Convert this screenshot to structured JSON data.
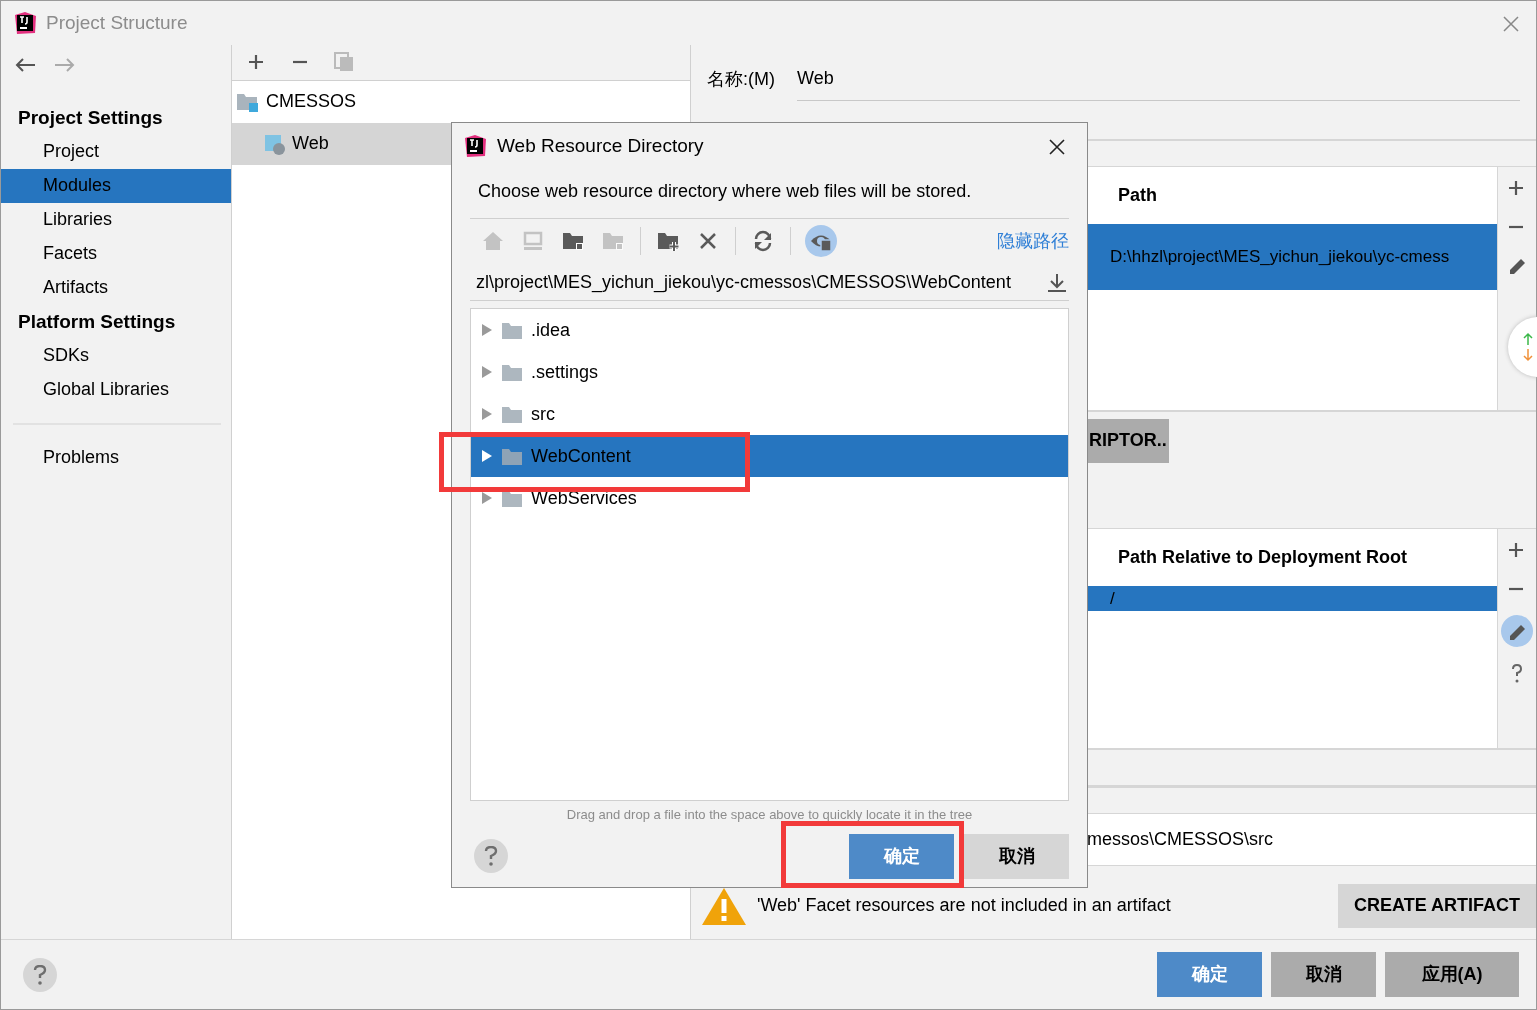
{
  "window": {
    "title": "Project Structure"
  },
  "sidebar": {
    "sections": [
      {
        "heading": "Project Settings",
        "items": [
          {
            "label": "Project",
            "selected": false
          },
          {
            "label": "Modules",
            "selected": true
          },
          {
            "label": "Libraries",
            "selected": false
          },
          {
            "label": "Facets",
            "selected": false
          },
          {
            "label": "Artifacts",
            "selected": false
          }
        ]
      },
      {
        "heading": "Platform Settings",
        "items": [
          {
            "label": "SDKs",
            "selected": false
          },
          {
            "label": "Global Libraries",
            "selected": false
          }
        ]
      }
    ],
    "bottom_items": [
      {
        "label": "Problems",
        "selected": false
      }
    ]
  },
  "module_tree": [
    {
      "label": "CMESSOS",
      "kind": "module",
      "selected": false,
      "children": [
        {
          "label": "Web",
          "kind": "facet",
          "selected": true
        }
      ]
    }
  ],
  "facet": {
    "name_label": "名称:(M)",
    "name_value": "Web",
    "descriptors_table": {
      "columns": [
        "Path"
      ],
      "rows": [
        {
          "cells": [
            "D:\\hhzl\\project\\MES_yichun_jiekou\\yc-cmess"
          ],
          "selected": true
        }
      ]
    },
    "descriptor_button": "RIPTOR..",
    "roots_table": {
      "columns": [
        "Path Relative to Deployment Root"
      ],
      "rows": [
        {
          "cells": [
            "/"
          ],
          "selected": true
        }
      ]
    },
    "source_root": "messos\\CMESSOS\\src",
    "warning": "'Web' Facet resources are not included in an artifact",
    "create_button": "CREATE ARTIFACT"
  },
  "buttons": [
    {
      "label": "确定",
      "kind": "primary"
    },
    {
      "label": "取消",
      "kind": "secondary"
    },
    {
      "label": "应用(A)",
      "kind": "secondary"
    }
  ],
  "dialog": {
    "title": "Web Resource Directory",
    "description": "Choose web resource directory where web files will be stored.",
    "toolbar": [
      {
        "kind": "home",
        "disabled": true
      },
      {
        "kind": "desktop",
        "disabled": true
      },
      {
        "kind": "module-folder",
        "disabled": false
      },
      {
        "kind": "project-folder",
        "disabled": true
      },
      {
        "kind": "separator"
      },
      {
        "kind": "new-folder",
        "disabled": false
      },
      {
        "kind": "delete",
        "disabled": false
      },
      {
        "kind": "separator"
      },
      {
        "kind": "refresh",
        "disabled": false
      },
      {
        "kind": "separator"
      },
      {
        "kind": "show-hidden",
        "disabled": false,
        "on": true
      }
    ],
    "hide_path_link": "隐藏路径",
    "path": "zl\\project\\MES_yichun_jiekou\\yc-cmessos\\CMESSOS\\WebContent",
    "tree": [
      {
        "label": ".idea",
        "selected": false
      },
      {
        "label": ".settings",
        "selected": false
      },
      {
        "label": "src",
        "selected": false
      },
      {
        "label": "WebContent",
        "selected": true
      },
      {
        "label": "WebServices",
        "selected": false
      }
    ],
    "hint": "Drag and drop a file into the space above to quickly locate it in the tree",
    "buttons": [
      {
        "label": "确定",
        "kind": "primary"
      },
      {
        "label": "取消",
        "kind": "secondary"
      }
    ]
  }
}
